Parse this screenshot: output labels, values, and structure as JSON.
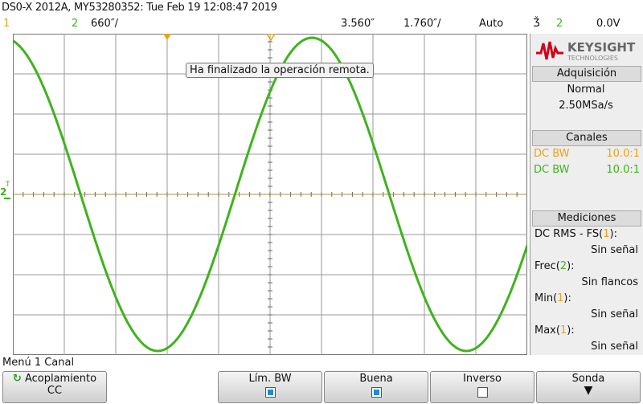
{
  "window": {
    "title": "DS0-X 2012A, MY53280352: Tue Feb 19 12:08:47 2019"
  },
  "status": {
    "ch1_num": "1",
    "ch2_num": "2",
    "ch2_scale": "660″/",
    "time_pos": "3.560″",
    "time_scale": "1.760″/",
    "trigger_mode": "Auto",
    "trigger_symbol": "Ǯ",
    "trigger_source": "2",
    "trigger_level": "0.0V"
  },
  "screen": {
    "message": "Ha finalizado la operación remota.",
    "ground_marker": "2",
    "trigger_marker": "T"
  },
  "panel": {
    "brand": "KEYSIGHT",
    "brand_sub": "TECHNOLOGIES",
    "acq_header": "Adquisición",
    "acq_mode": "Normal",
    "acq_rate": "2.50MSa/s",
    "ch_header": "Canales",
    "channels": [
      {
        "coupling": "DC BW",
        "probe": "10.0:1",
        "color": "#e8a317"
      },
      {
        "coupling": "DC BW",
        "probe": "10.0:1",
        "color": "#3fb31d"
      }
    ],
    "meas_header": "Mediciones",
    "meas": [
      {
        "label": "DC RMS - FS(",
        "src": "1",
        "label_end": "):",
        "value": "Sin señal"
      },
      {
        "label": "Frec(",
        "src": "2",
        "label_end": "):",
        "value": "Sin flancos"
      },
      {
        "label": "Min(",
        "src": "1",
        "label_end": "):",
        "value": "Sin señal"
      },
      {
        "label": "Max(",
        "src": "1",
        "label_end": "):",
        "value": "Sin señal"
      }
    ]
  },
  "menu": {
    "title": "Menú 1 Canal",
    "coupling_label": "Acoplamiento",
    "coupling_value": "CC",
    "bwlimit_label": "Lím. BW",
    "bwlimit_on": true,
    "fine_label": "Buena",
    "fine_on": true,
    "invert_label": "Inverso",
    "invert_on": false,
    "probe_label": "Sonda"
  },
  "colors": {
    "ch1": "#e8a317",
    "ch2": "#3fb31d",
    "grid": "#777777",
    "select": "#1a8fd6"
  },
  "waveform": {
    "channel": "2",
    "shape": "cosine",
    "time_per_div_us": 1.76,
    "volts_per_div_mv": 660,
    "amplitude_divs": 3.9,
    "period_divs": 6.0,
    "phase_deg": 11
  }
}
